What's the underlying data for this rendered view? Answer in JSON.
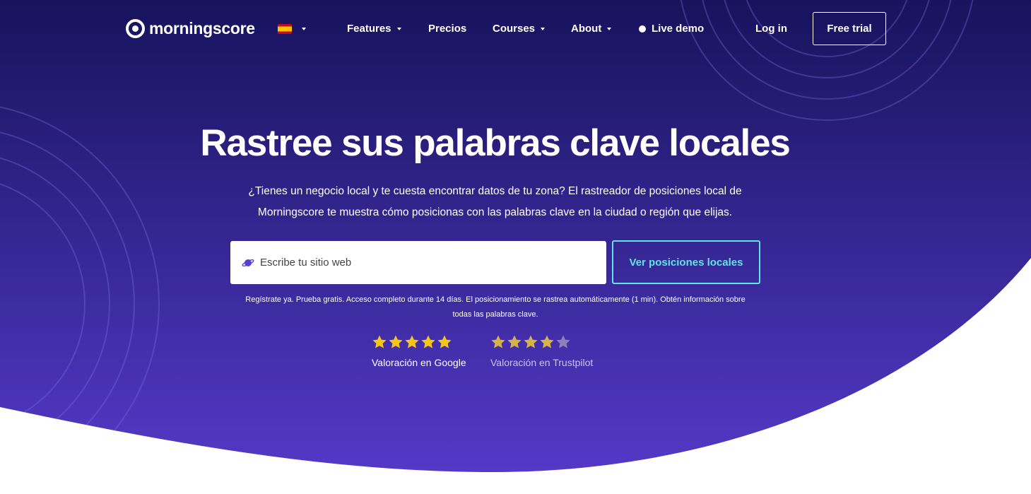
{
  "brand": {
    "name": "morningscore"
  },
  "nav": {
    "language": "es",
    "items": [
      {
        "label": "Features",
        "dropdown": true
      },
      {
        "label": "Precios",
        "dropdown": false
      },
      {
        "label": "Courses",
        "dropdown": true
      },
      {
        "label": "About",
        "dropdown": true
      }
    ],
    "live_demo": "Live demo",
    "login": "Log in",
    "free_trial": "Free trial"
  },
  "hero": {
    "title": "Rastree sus palabras clave locales",
    "subtitle_line1": "¿Tienes un negocio local y te cuesta encontrar datos de tu zona? El rastreador de posiciones local de",
    "subtitle_line2": "Morningscore te muestra cómo posicionas con las palabras clave en la ciudad o región que elijas.",
    "search_placeholder": "Escribe tu sitio web",
    "cta": "Ver posiciones locales",
    "note_line1": "Regístrate ya. Prueba gratis. Acceso completo durante 14 días. El posicionamiento se rastrea automáticamente (1 min). Obtén información sobre",
    "note_line2": "todas las palabras clave."
  },
  "ratings": [
    {
      "label": "Valoración en Google",
      "stars": 5,
      "filled": 5,
      "color": "#f5c518",
      "label_color": "#ffffff"
    },
    {
      "label": "Valoración en Trustpilot",
      "stars": 5,
      "filled": 4,
      "color": "#d4b44a",
      "label_color": "#c9c6ee"
    }
  ],
  "colors": {
    "hero_top": "#17135c",
    "hero_bottom": "#5339c7",
    "accent": "#5ee6e6",
    "star_empty": "#8d80ba"
  }
}
